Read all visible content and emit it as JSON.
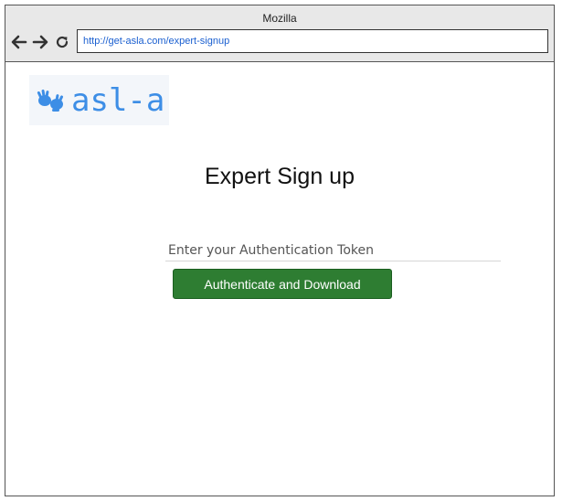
{
  "window": {
    "title": "Mozilla"
  },
  "toolbar": {
    "back_icon": "arrow-left-icon",
    "forward_icon": "arrow-right-icon",
    "reload_icon": "reload-icon",
    "url": "http://get-asla.com/expert-signup"
  },
  "logo": {
    "text": "asl-a",
    "icon": "sign-language-hands-icon",
    "color": "#3d8ee6"
  },
  "main": {
    "title": "Expert Sign up",
    "token_placeholder": "Enter your Authentication Token",
    "token_value": "",
    "button_label": "Authenticate and Download",
    "button_color": "#2e7d32"
  }
}
